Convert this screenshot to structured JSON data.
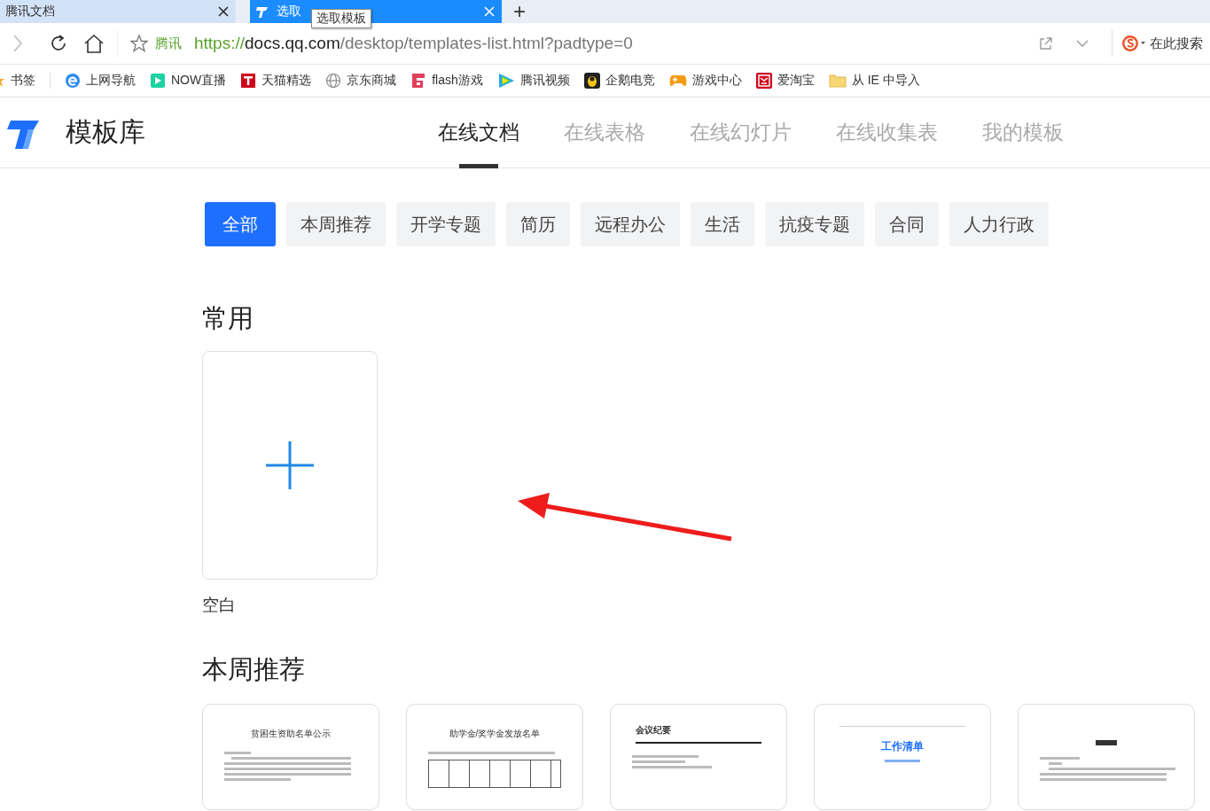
{
  "browser": {
    "tabs": [
      {
        "title": "腾讯文档",
        "selected": false
      },
      {
        "title": "选取",
        "selected": true
      }
    ],
    "new_tab": "+",
    "tooltip": "选取模板",
    "address": {
      "site_label": "腾讯",
      "scheme": "https://",
      "host": "docs.qq.com",
      "path": "/desktop/templates-list.html?padtype=0"
    },
    "search": {
      "placeholder": "在此搜索"
    },
    "bookmarks": [
      {
        "label": "书签"
      },
      {
        "label": "上网导航"
      },
      {
        "label": "NOW直播"
      },
      {
        "label": "天猫精选"
      },
      {
        "label": "京东商城"
      },
      {
        "label": "flash游戏"
      },
      {
        "label": "腾讯视频"
      },
      {
        "label": "企鹅电竞"
      },
      {
        "label": "游戏中心"
      },
      {
        "label": "爱淘宝"
      },
      {
        "label": "从 IE 中导入"
      }
    ]
  },
  "app": {
    "title": "模板库",
    "nav": [
      {
        "label": "在线文档",
        "selected": true
      },
      {
        "label": "在线表格",
        "selected": false
      },
      {
        "label": "在线幻灯片",
        "selected": false
      },
      {
        "label": "在线收集表",
        "selected": false
      },
      {
        "label": "我的模板",
        "selected": false
      }
    ],
    "categories": [
      {
        "label": "全部",
        "selected": true
      },
      {
        "label": "本周推荐",
        "selected": false
      },
      {
        "label": "开学专题",
        "selected": false
      },
      {
        "label": "简历",
        "selected": false
      },
      {
        "label": "远程办公",
        "selected": false
      },
      {
        "label": "生活",
        "selected": false
      },
      {
        "label": "抗疫专题",
        "selected": false
      },
      {
        "label": "合同",
        "selected": false
      },
      {
        "label": "人力行政",
        "selected": false
      }
    ],
    "sections": [
      {
        "title": "常用",
        "cards": [
          {
            "kind": "blank",
            "label": "空白"
          }
        ]
      },
      {
        "title": "本周推荐",
        "cards": [
          {
            "kind": "notice",
            "title": "贫困生资助名单公示"
          },
          {
            "kind": "table",
            "title": "助学金/奖学金发放名单"
          },
          {
            "kind": "minutes",
            "title": "会议纪要"
          },
          {
            "kind": "cover",
            "title": "工作清单"
          },
          {
            "kind": "letter"
          }
        ]
      }
    ]
  }
}
